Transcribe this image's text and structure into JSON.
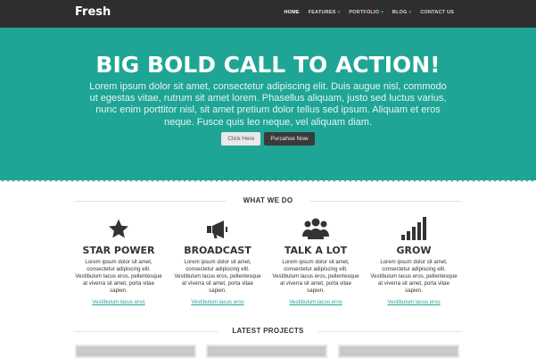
{
  "brand": {
    "name": "Fresh"
  },
  "nav": {
    "items": [
      {
        "label": "HOME",
        "active": true,
        "dropdown": false
      },
      {
        "label": "FEATURES",
        "active": false,
        "dropdown": true
      },
      {
        "label": "PORTFOLIO",
        "active": false,
        "dropdown": true
      },
      {
        "label": "BLOG",
        "active": false,
        "dropdown": true
      },
      {
        "label": "CONTACT US",
        "active": false,
        "dropdown": false
      }
    ]
  },
  "hero": {
    "title": "BIG BOLD CALL TO ACTION!",
    "text": "Lorem ipsum dolor sit amet, consectetur adipiscing elit. Duis augue nisl, commodo ut egestas vitae, rutrum sit amet lorem. Phasellus aliquam, justo sed luctus varius, nunc enim porttitor nisl, sit amet pretium dolor tellus sed ipsum. Aliquam et eros neque. Fusce quis leo neque, vel aliquam diam.",
    "primary_button": "Click Here",
    "secondary_button": "Purcahse Now"
  },
  "what_we_do": {
    "heading": "WHAT WE DO",
    "features": [
      {
        "icon": "star-icon",
        "title": "STAR POWER",
        "text": "Lorem ipsum dolor sit amet, consectetur adipiscing elit. Vestibulum lacus eros, pellentesque at viverra sit amet, porta vitae sapien.",
        "link": "Vestibulum lacus eros"
      },
      {
        "icon": "megaphone-icon",
        "title": "BROADCAST",
        "text": "Lorem ipsum dolor sit amet, consectetur adipiscing elit. Vestibulum lacus eros, pellentesque at viverra sit amet, porta vitae sapien.",
        "link": "Vestibulum lacus eros"
      },
      {
        "icon": "people-icon",
        "title": "TALK A LOT",
        "text": "Lorem ipsum dolor sit amet, consectetur adipiscing elit. Vestibulum lacus eros, pellentesque at viverra sit amet, porta vitae sapien.",
        "link": "Vestibulum lacus eros"
      },
      {
        "icon": "signal-bars-icon",
        "title": "GROW",
        "text": "Lorem ipsum dolor sit amet, consectetur adipiscing elit. Vestibulum lacus eros, pellentesque at viverra sit amet, porta vitae sapien.",
        "link": "Vestibulum lacus eros"
      }
    ]
  },
  "latest_projects": {
    "heading": "LATEST PROJECTS"
  },
  "colors": {
    "accent": "#1fa595",
    "topbar": "#2e2e2e",
    "text": "#333333"
  }
}
